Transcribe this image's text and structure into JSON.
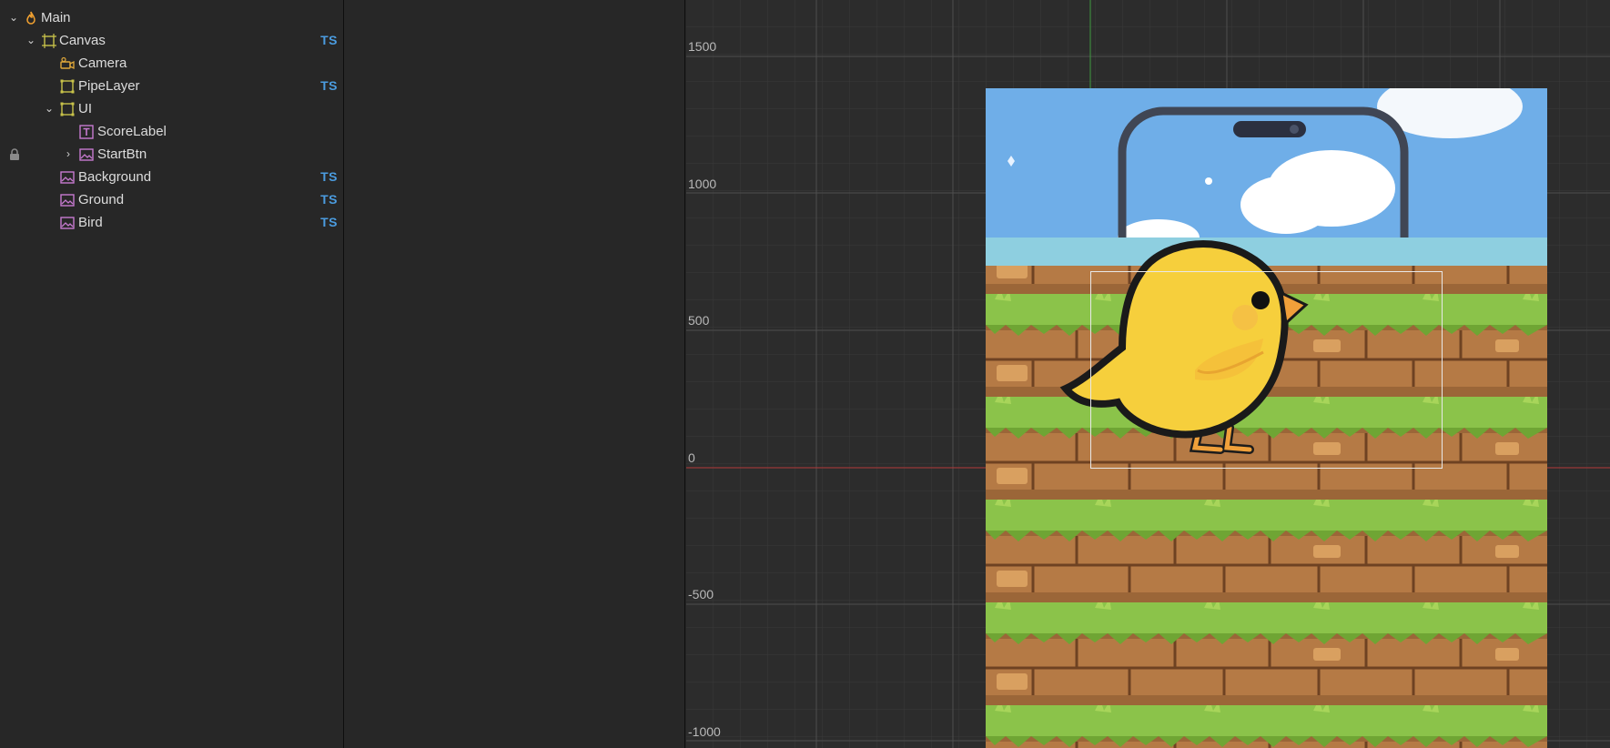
{
  "hierarchy": {
    "nodes": [
      {
        "label": "Main",
        "icon": "scene-fire-icon",
        "expanded": true,
        "ts": ""
      },
      {
        "label": "Canvas",
        "icon": "canvas-node-icon",
        "expanded": true,
        "ts": "TS"
      },
      {
        "label": "Camera",
        "icon": "camera-icon",
        "ts": ""
      },
      {
        "label": "PipeLayer",
        "icon": "node-frame-icon",
        "ts": "TS"
      },
      {
        "label": "UI",
        "icon": "node-frame-icon",
        "expanded": true,
        "ts": ""
      },
      {
        "label": "ScoreLabel",
        "icon": "text-label-icon",
        "ts": ""
      },
      {
        "label": "StartBtn",
        "icon": "sprite-image-icon",
        "expanded": false,
        "locked": true,
        "ts": ""
      },
      {
        "label": "Background",
        "icon": "sprite-image-icon",
        "ts": "TS"
      },
      {
        "label": "Ground",
        "icon": "sprite-image-icon",
        "ts": "TS"
      },
      {
        "label": "Bird",
        "icon": "sprite-image-icon",
        "ts": "TS"
      }
    ]
  },
  "scene": {
    "y_axis_labels": [
      "1500",
      "1000",
      "500",
      "0",
      "-500",
      "-1000"
    ],
    "colors": {
      "x_axis": "#b33a3a",
      "y_axis": "#3f9a3f",
      "ts_badge": "#4b9ce0",
      "sky": "#6faee8",
      "grass": "#8bc34a",
      "brick": "#b57a45",
      "bird": "#f6cf3c",
      "beak": "#f0a03a"
    }
  }
}
